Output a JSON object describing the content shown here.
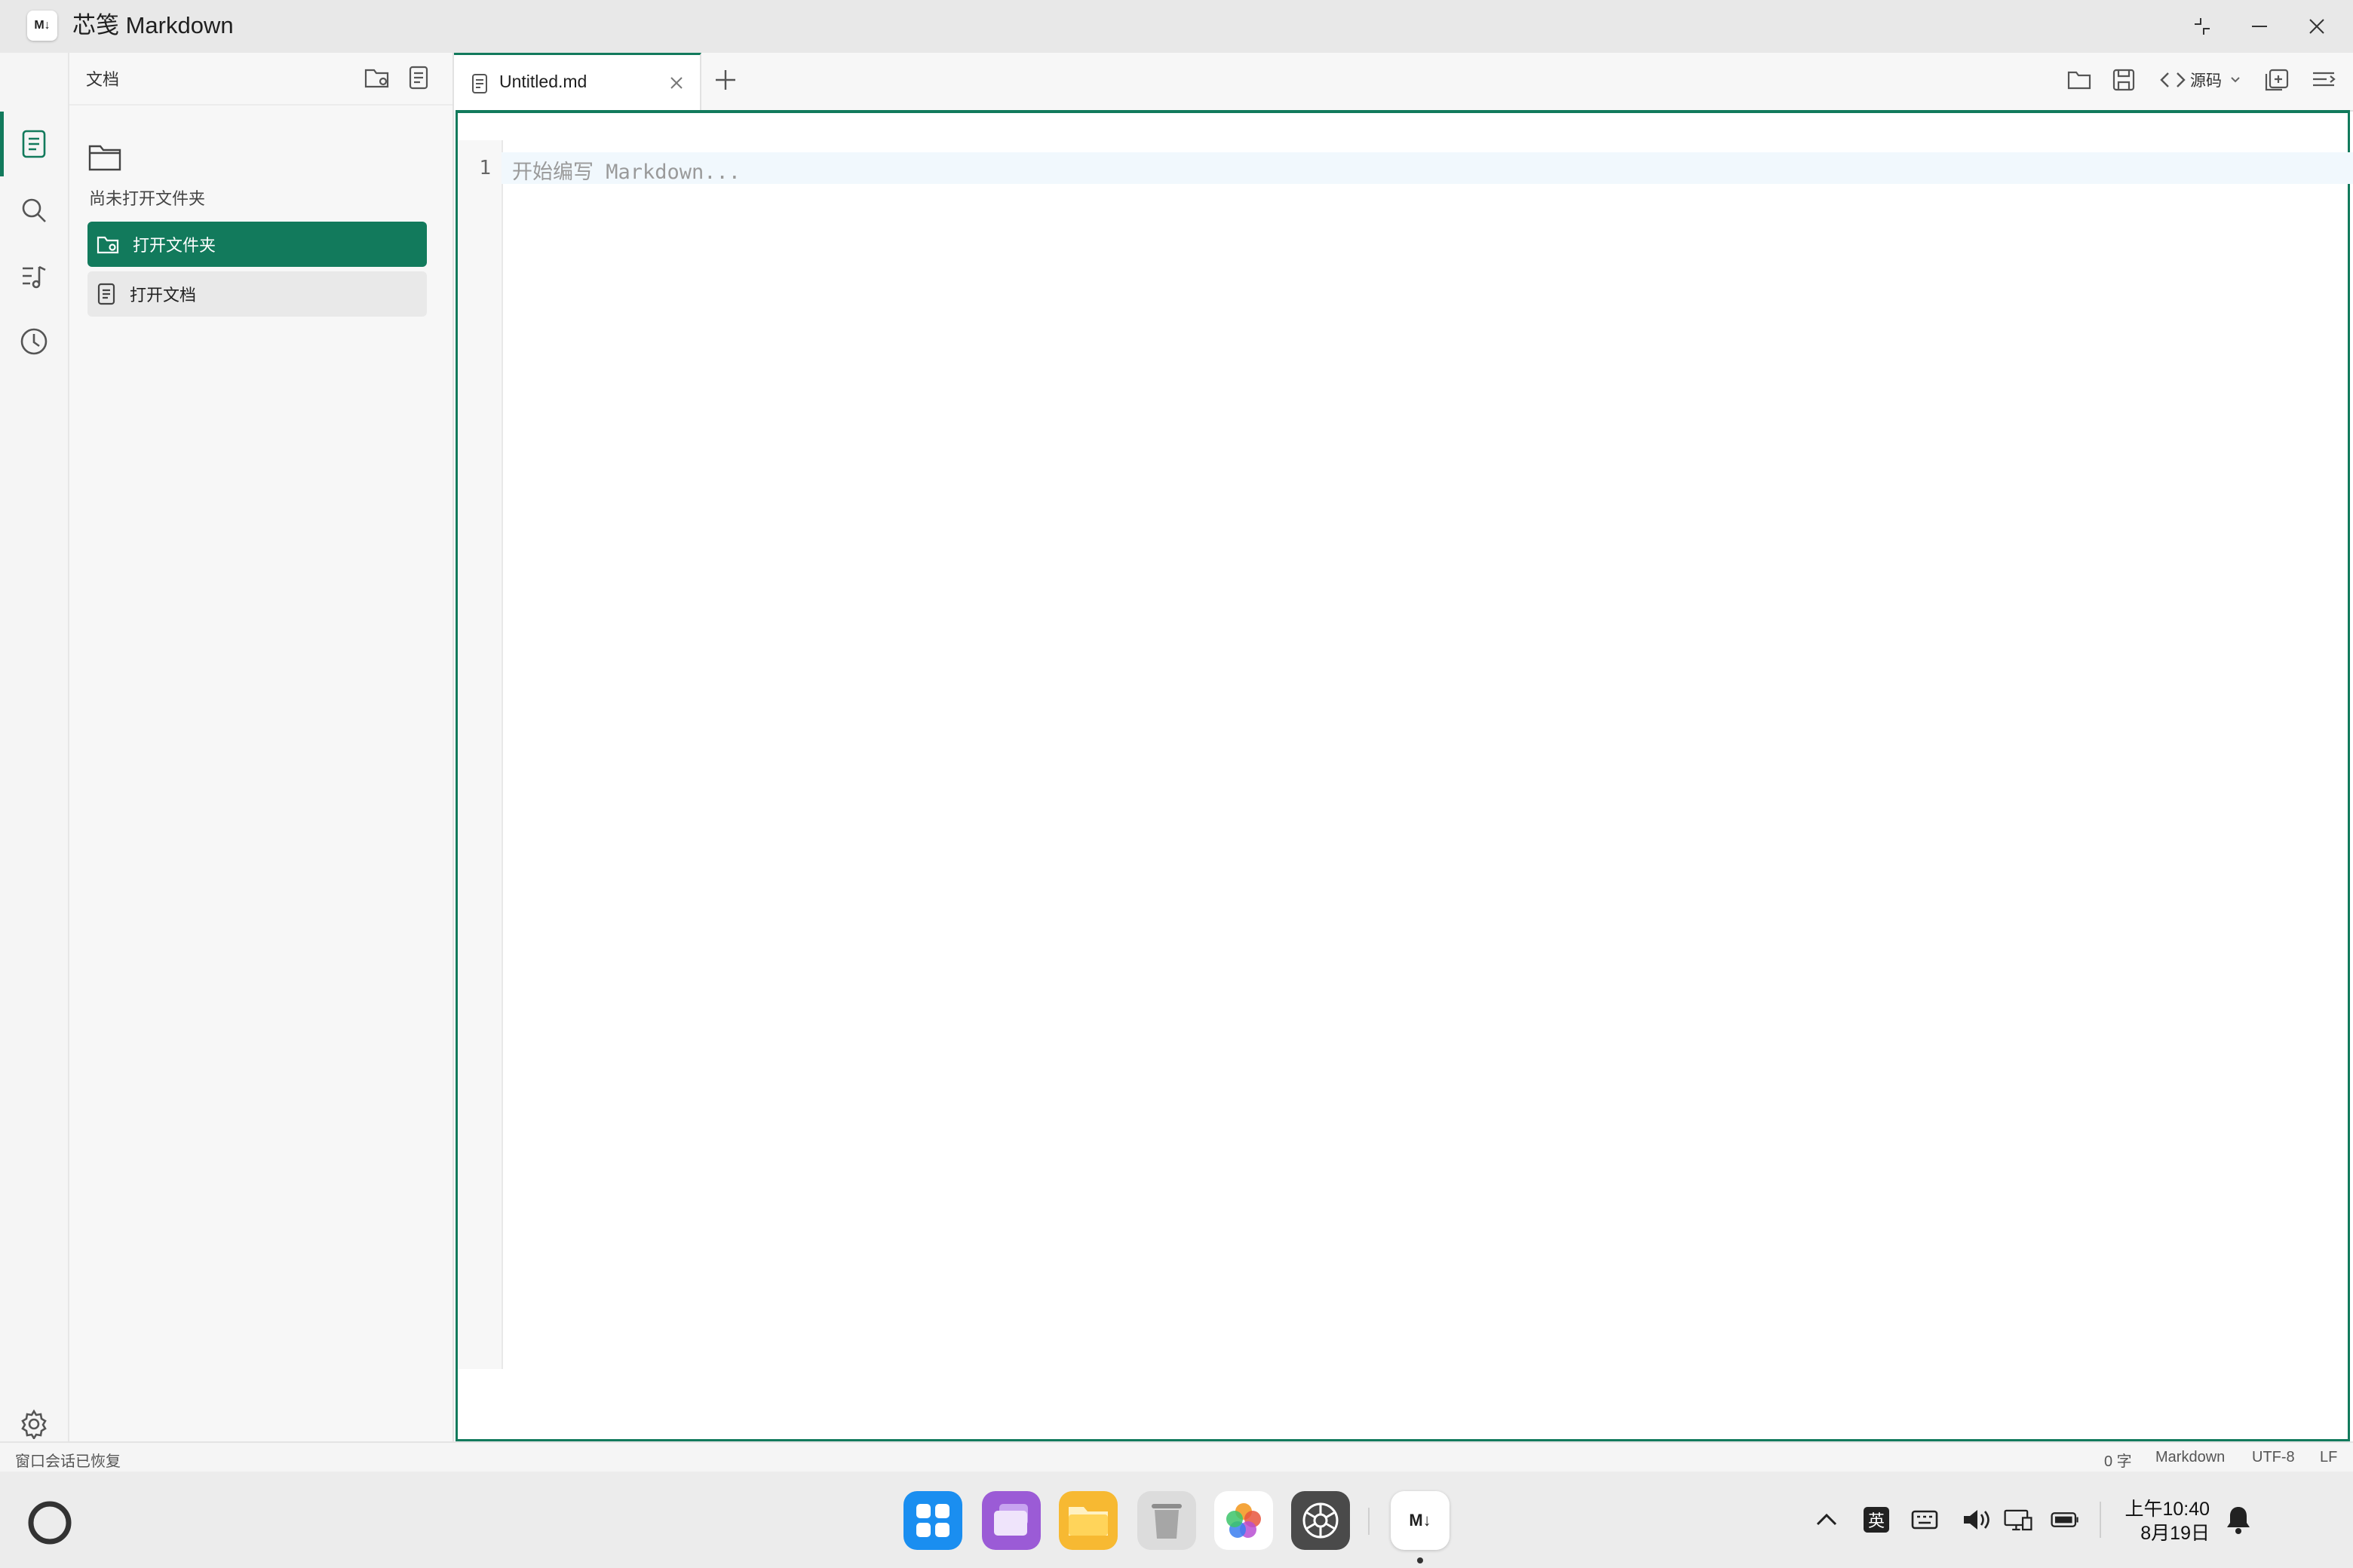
{
  "window": {
    "title": "芯笺 Markdown",
    "app_icon_text": "M↓"
  },
  "activity_bar": {
    "items": [
      "document-icon",
      "search-icon",
      "outline-icon",
      "history-icon"
    ],
    "bottom": "gear-icon"
  },
  "sidebar": {
    "title": "文档",
    "empty_text": "尚未打开文件夹",
    "open_folder_label": "打开文件夹",
    "open_document_label": "打开文档"
  },
  "tabs": [
    {
      "label": "Untitled.md",
      "active": true
    }
  ],
  "toolbar": {
    "view_mode_label": "源码"
  },
  "editor": {
    "line_number": "1",
    "placeholder": "开始编写 Markdown..."
  },
  "status_bar": {
    "message": "窗口会话已恢复",
    "word_count": "0 字",
    "language": "Markdown",
    "encoding": "UTF-8",
    "line_ending": "LF"
  },
  "taskbar": {
    "ime_label": "英",
    "time": "上午10:40",
    "date": "8月19日"
  },
  "colors": {
    "accent": "#127a5c",
    "active_line": "#f1f8fd"
  }
}
